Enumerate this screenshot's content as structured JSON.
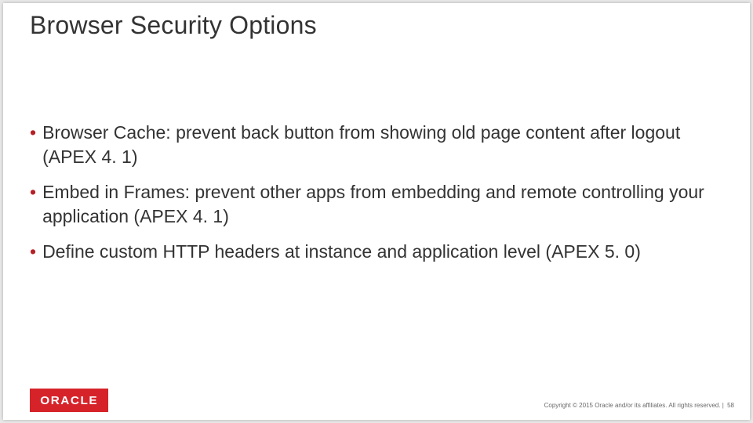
{
  "slide": {
    "title": "Browser Security Options",
    "bullets": [
      "Browser Cache: prevent back button from showing old page content after logout (APEX 4. 1)",
      "Embed in Frames: prevent other apps from embedding and remote controlling your application (APEX 4. 1)",
      "Define custom HTTP headers at instance and application level (APEX 5. 0)"
    ],
    "logo_text": "ORACLE",
    "copyright": "Copyright © 2015 Oracle and/or its affiliates. All rights reserved.  |",
    "page_number": "58"
  }
}
